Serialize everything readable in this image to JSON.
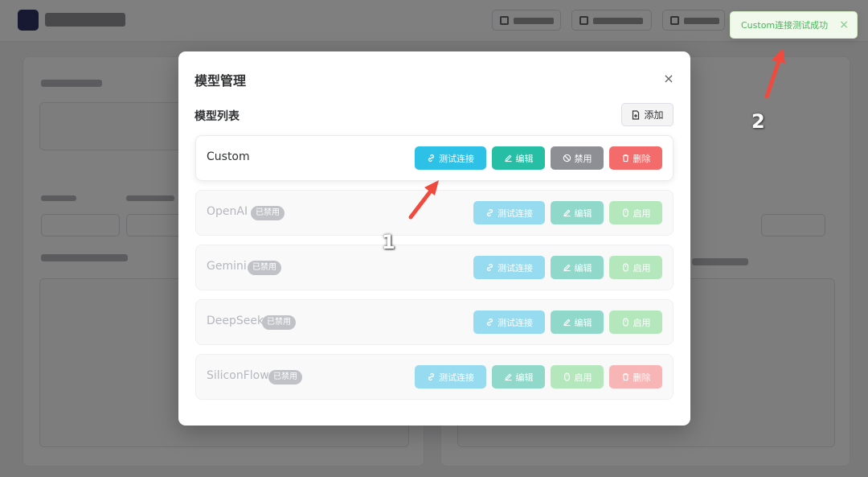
{
  "modal": {
    "title": "模型管理",
    "close_icon": "×",
    "section_title": "模型列表",
    "add_label": "添加"
  },
  "models": [
    {
      "name": "Custom",
      "badge": "",
      "state": "enabled",
      "actions": [
        {
          "kind": "test",
          "label": "测试连接",
          "icon": "link-icon"
        },
        {
          "kind": "edit",
          "label": "编辑",
          "icon": "edit-icon"
        },
        {
          "kind": "disable",
          "label": "禁用",
          "icon": "ban-icon"
        },
        {
          "kind": "delete",
          "label": "删除",
          "icon": "trash-icon"
        }
      ]
    },
    {
      "name": "OpenAI",
      "badge": "已禁用",
      "state": "disabled",
      "actions": [
        {
          "kind": "test",
          "label": "测试连接",
          "icon": "link-icon"
        },
        {
          "kind": "edit",
          "label": "编辑",
          "icon": "edit-icon"
        },
        {
          "kind": "enable",
          "label": "启用",
          "icon": "mouse-icon"
        }
      ]
    },
    {
      "name": "Gemini",
      "badge": "已禁用",
      "state": "disabled",
      "actions": [
        {
          "kind": "test",
          "label": "测试连接",
          "icon": "link-icon"
        },
        {
          "kind": "edit",
          "label": "编辑",
          "icon": "edit-icon"
        },
        {
          "kind": "enable",
          "label": "启用",
          "icon": "mouse-icon"
        }
      ]
    },
    {
      "name": "DeepSeek",
      "badge": "已禁用",
      "state": "disabled",
      "actions": [
        {
          "kind": "test",
          "label": "测试连接",
          "icon": "link-icon"
        },
        {
          "kind": "edit",
          "label": "编辑",
          "icon": "edit-icon"
        },
        {
          "kind": "enable",
          "label": "启用",
          "icon": "mouse-icon"
        }
      ]
    },
    {
      "name": "SiliconFlow",
      "badge": "已禁用",
      "state": "disabled",
      "actions": [
        {
          "kind": "test",
          "label": "测试连接",
          "icon": "link-icon"
        },
        {
          "kind": "edit",
          "label": "编辑",
          "icon": "edit-icon"
        },
        {
          "kind": "enable",
          "label": "启用",
          "icon": "mouse-icon"
        },
        {
          "kind": "delete",
          "label": "删除",
          "icon": "trash-icon"
        }
      ]
    }
  ],
  "toast": {
    "message": "Custom连接测试成功",
    "close_icon": "×"
  },
  "annotations": {
    "one": "1",
    "two": "2"
  },
  "colors": {
    "test": "#2ec1e8",
    "edit": "#26bfa5",
    "disable": "#8d8f94",
    "enable": "#7cd68a",
    "delete": "#f36b6b",
    "arrow": "#f04a3e"
  }
}
